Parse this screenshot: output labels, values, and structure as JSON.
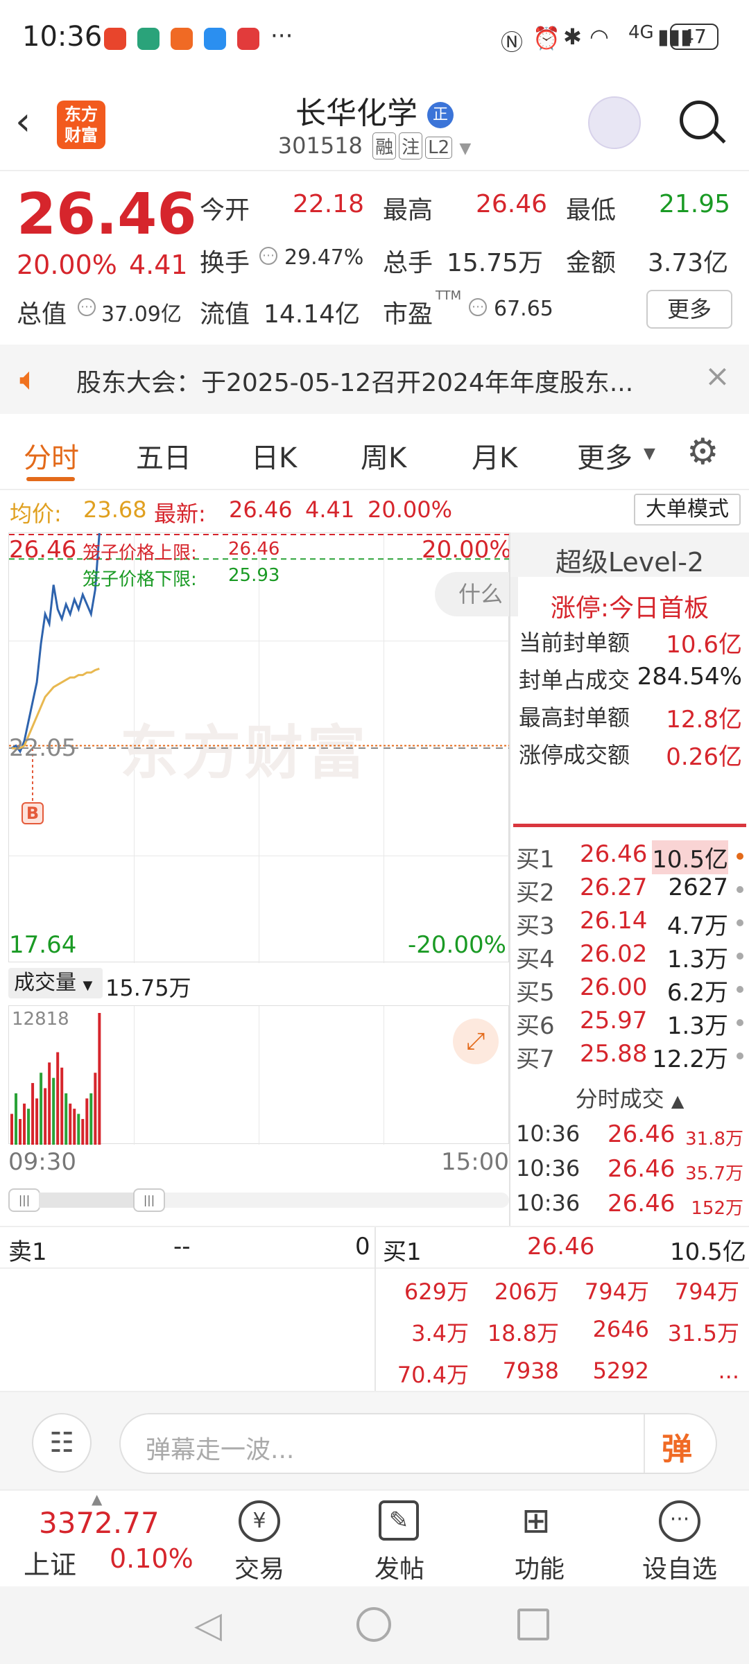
{
  "status": {
    "time": "10:36",
    "battery": "47",
    "network": "4G"
  },
  "header": {
    "logo_line1": "东方",
    "logo_line2": "财富",
    "title": "长华化学",
    "title_badge": "正",
    "code": "301518",
    "tags": [
      "融",
      "注",
      "L2"
    ]
  },
  "quote": {
    "price": "26.46",
    "pct": "20.00%",
    "change": "4.41",
    "open_label": "今开",
    "open": "22.18",
    "high_label": "最高",
    "high": "26.46",
    "low_label": "最低",
    "low": "21.95",
    "turnover_label": "换手",
    "turnover": "29.47%",
    "volume_label": "总手",
    "volume": "15.75万",
    "amount_label": "金额",
    "amount": "3.73亿",
    "mktcap_label": "总值",
    "mktcap": "37.09亿",
    "float_label": "流值",
    "float": "14.14亿",
    "pe_label": "市盈",
    "pe_sup": "TTM",
    "pe": "67.65",
    "more": "更多"
  },
  "notice": {
    "text": "股东大会：于2025-05-12召开2024年年度股东..."
  },
  "tabs": [
    "分时",
    "五日",
    "日K",
    "周K",
    "月K",
    "更多"
  ],
  "avgbar": {
    "avg_label": "均价:",
    "avg": "23.68",
    "latest_label": "最新:",
    "latest": "26.46",
    "change": "4.41",
    "pct": "20.00%",
    "mode_button": "大单模式"
  },
  "chart": {
    "top_price": "26.46",
    "top_pct": "20.00%",
    "mid_price": "22.05",
    "bottom_price": "17.64",
    "bottom_pct": "-20.00%",
    "cage_upper_label": "笼子价格上限:",
    "cage_upper": "26.46",
    "cage_lower_label": "笼子价格下限:",
    "cage_lower": "25.93",
    "ask_hint": "什么",
    "watermark": "东方财富",
    "buy_marker": "B",
    "volume_label": "成交量",
    "volume_total": "15.75万",
    "volume_max": "12818",
    "start_time": "09:30",
    "end_time": "15:00"
  },
  "chart_data": {
    "type": "line",
    "x_range": [
      "09:30",
      "15:00"
    ],
    "ylim": [
      17.64,
      26.46
    ],
    "series": [
      {
        "name": "",
        "values": [
          22.05,
          22.1,
          21.98,
          22.2,
          22.6,
          23.0,
          23.4,
          24.2,
          24.8,
          24.6,
          25.4,
          24.9,
          24.7,
          25.0,
          24.8,
          25.1,
          24.9,
          25.2,
          25.0,
          24.8,
          25.3,
          26.46
        ]
      },
      {
        "name": "",
        "values": [
          22.05,
          22.04,
          22.05,
          22.1,
          22.3,
          22.5,
          22.7,
          22.9,
          23.1,
          23.2,
          23.3,
          23.35,
          23.4,
          23.45,
          23.5,
          23.5,
          23.55,
          23.55,
          23.6,
          23.6,
          23.65,
          23.68
        ]
      }
    ],
    "volume": [
      3000,
      5000,
      2500,
      4000,
      3500,
      6000,
      4500,
      7000,
      5500,
      8000,
      6500,
      9000,
      7500,
      5000,
      4000,
      3500,
      3000,
      2500,
      4500,
      5000,
      7000,
      12818
    ]
  },
  "level2": {
    "title": "超级Level-2",
    "limit_label": "涨停:",
    "limit_text": "今日首板",
    "rows": [
      {
        "label": "当前封单额",
        "value": "10.6亿"
      },
      {
        "label": "封单占成交",
        "value": "284.54%"
      },
      {
        "label": "最高封单额",
        "value": "12.8亿"
      },
      {
        "label": "涨停成交额",
        "value": "0.26亿"
      }
    ]
  },
  "bids": [
    {
      "label": "买1",
      "price": "26.46",
      "vol": "10.5亿"
    },
    {
      "label": "买2",
      "price": "26.27",
      "vol": "2627"
    },
    {
      "label": "买3",
      "price": "26.14",
      "vol": "4.7万"
    },
    {
      "label": "买4",
      "price": "26.02",
      "vol": "1.3万"
    },
    {
      "label": "买5",
      "price": "26.00",
      "vol": "6.2万"
    },
    {
      "label": "买6",
      "price": "25.97",
      "vol": "1.3万"
    },
    {
      "label": "买7",
      "price": "25.88",
      "vol": "12.2万"
    }
  ],
  "ticks": {
    "title": "分时成交",
    "rows": [
      {
        "time": "10:36",
        "price": "26.46",
        "vol": "31.8万"
      },
      {
        "time": "10:36",
        "price": "26.46",
        "vol": "35.7万"
      },
      {
        "time": "10:36",
        "price": "26.46",
        "vol": "152万"
      }
    ]
  },
  "queue": {
    "sell_label": "卖1",
    "sell_price": "--",
    "sell_vol": "0",
    "buy_label": "买1",
    "buy_price": "26.46",
    "buy_vol": "10.5亿",
    "cells": [
      [
        "629万",
        "206万",
        "794万",
        "794万"
      ],
      [
        "3.4万",
        "18.8万",
        "2646",
        "31.5万"
      ],
      [
        "70.4万",
        "7938",
        "5292",
        "..."
      ]
    ]
  },
  "comment": {
    "placeholder": "弹幕走一波...",
    "danmu_button": "弹"
  },
  "nav": {
    "index_value": "3372.77",
    "index_name": "上证",
    "index_pct": "0.10%",
    "items": [
      "交易",
      "发帖",
      "功能",
      "设自选"
    ]
  }
}
